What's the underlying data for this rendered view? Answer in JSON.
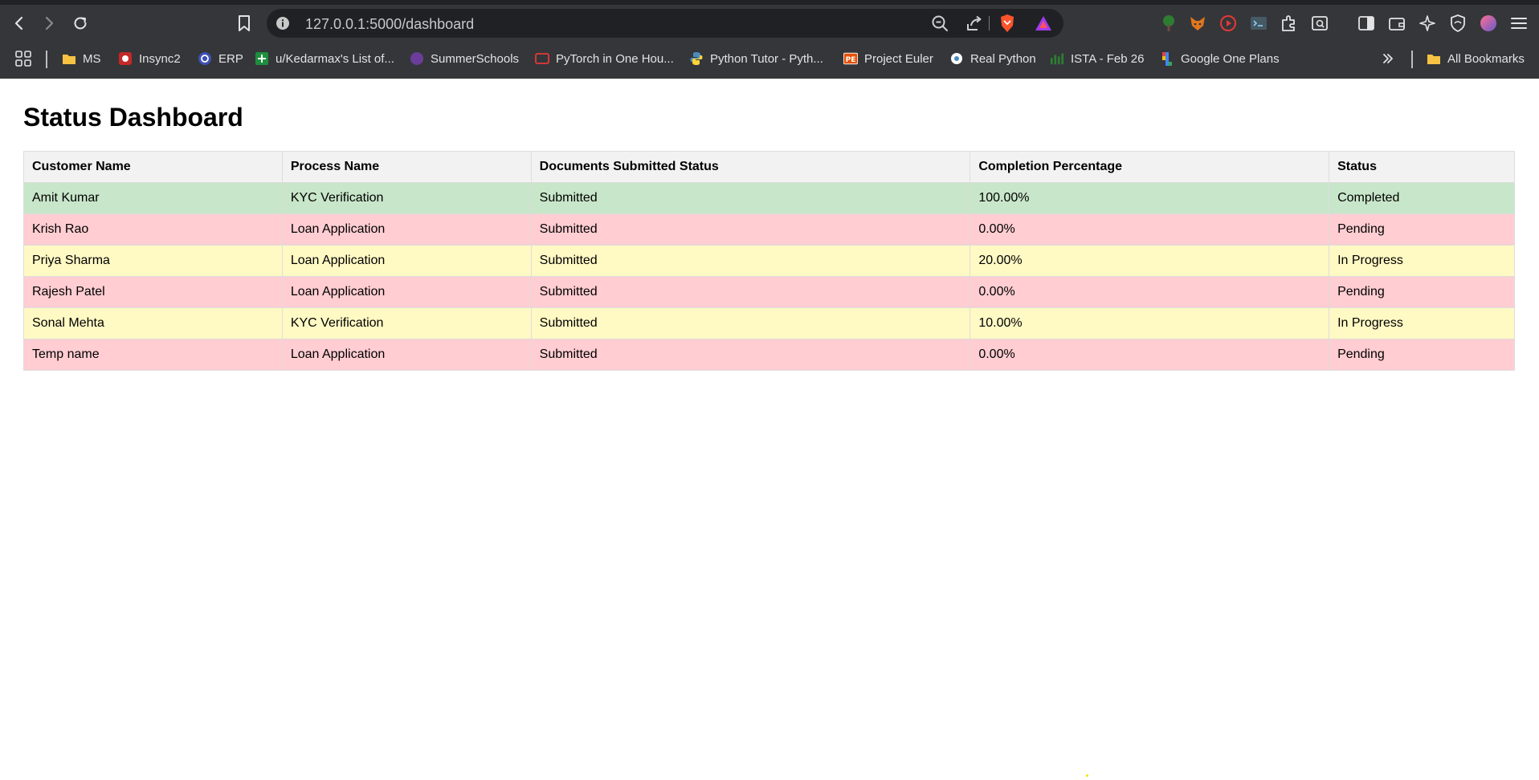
{
  "browser": {
    "url": "127.0.0.1:5000/dashboard",
    "bookmarks": [
      {
        "label": "MS",
        "icon": "folder-icon",
        "color": "#f6c343"
      },
      {
        "label": "Insync2",
        "icon": "insync-icon",
        "color": "#c62828"
      },
      {
        "label": "ERP",
        "icon": "erp-icon",
        "color": "#3f51b5"
      },
      {
        "label": "u/Kedarmax's List of...",
        "icon": "sheets-icon",
        "color": "#1e8e3e"
      },
      {
        "label": "SummerSchools",
        "icon": "summerschools-icon",
        "color": "#6a3d9a"
      },
      {
        "label": "PyTorch in One Hou...",
        "icon": "pytorch-icon",
        "color": "#e53935"
      },
      {
        "label": "Python Tutor - Pyth...",
        "icon": "python-icon",
        "color": "#4b8bbe"
      },
      {
        "label": "Project Euler",
        "icon": "project-euler-icon",
        "color": "#e65100"
      },
      {
        "label": "Real Python",
        "icon": "real-python-icon",
        "color": "#ffffff"
      },
      {
        "label": "ISTA - Feb 26",
        "icon": "ista-icon",
        "color": "#2e7d32"
      },
      {
        "label": "Google One Plans",
        "icon": "google-one-icon",
        "color": "#fbbc04"
      }
    ],
    "all_bookmarks": "All Bookmarks"
  },
  "page": {
    "title": "Status Dashboard"
  },
  "table": {
    "headers": [
      "Customer Name",
      "Process Name",
      "Documents Submitted Status",
      "Completion Percentage",
      "Status"
    ],
    "rows": [
      {
        "customer": "Amit Kumar",
        "process": "KYC Verification",
        "documents": "Submitted",
        "completion": "100.00%",
        "status": "Completed",
        "row_color": "#c8e6c9"
      },
      {
        "customer": "Krish Rao",
        "process": "Loan Application",
        "documents": "Submitted",
        "completion": "0.00%",
        "status": "Pending",
        "row_color": "#ffcdd2"
      },
      {
        "customer": "Priya Sharma",
        "process": "Loan Application",
        "documents": "Submitted",
        "completion": "20.00%",
        "status": "In Progress",
        "row_color": "#fff9c4"
      },
      {
        "customer": "Rajesh Patel",
        "process": "Loan Application",
        "documents": "Submitted",
        "completion": "0.00%",
        "status": "Pending",
        "row_color": "#ffcdd2"
      },
      {
        "customer": "Sonal Mehta",
        "process": "KYC Verification",
        "documents": "Submitted",
        "completion": "10.00%",
        "status": "In Progress",
        "row_color": "#fff9c4"
      },
      {
        "customer": "Temp name",
        "process": "Loan Application",
        "documents": "Submitted",
        "completion": "0.00%",
        "status": "Pending",
        "row_color": "#ffcdd2"
      }
    ]
  }
}
